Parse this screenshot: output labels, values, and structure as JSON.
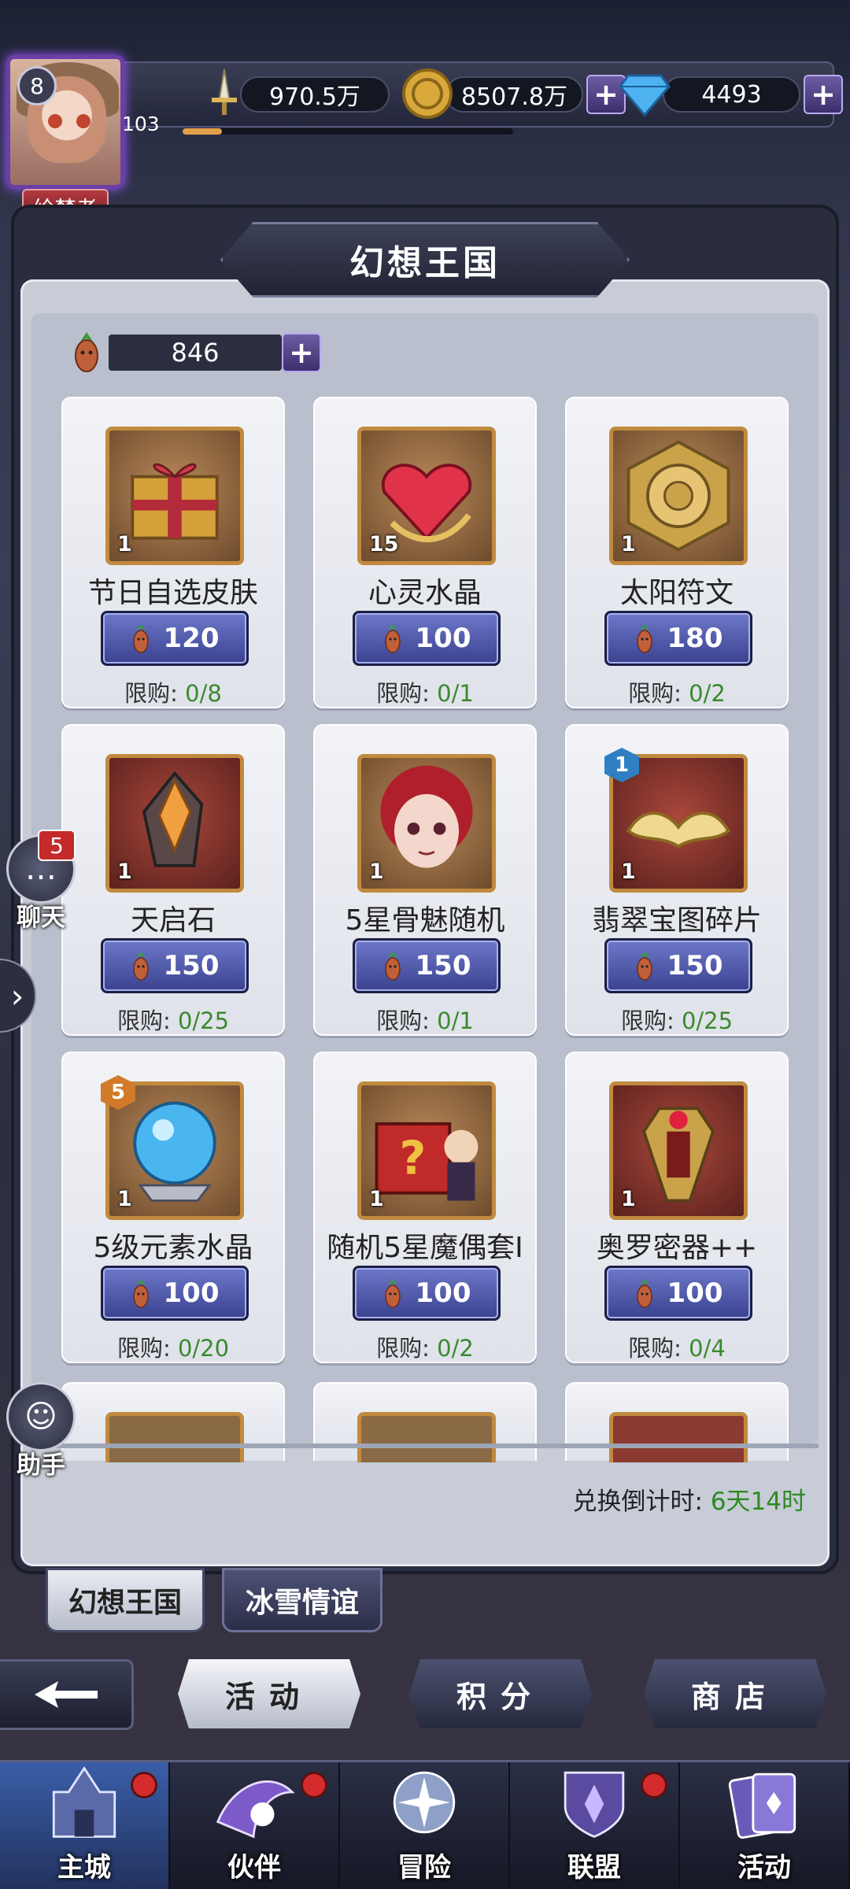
{
  "header": {
    "level": "8",
    "player_title": "绘梦者",
    "exp_value": "103",
    "exp_fraction": 0.12,
    "power": "970.5万",
    "gold": "8507.8万",
    "diamonds": "4493"
  },
  "panel": {
    "title": "幻想王国",
    "currency_count": "846",
    "countdown_label": "兑换倒计时: ",
    "countdown_value": "6天14时"
  },
  "items": [
    {
      "name": "节日自选皮肤",
      "count": "1",
      "price": "120",
      "limit_label": "限购: ",
      "limit": "0/8",
      "icon": "gift-box-icon",
      "bg": "brown"
    },
    {
      "name": "心灵水晶",
      "count": "15",
      "price": "100",
      "limit_label": "限购: ",
      "limit": "0/1",
      "icon": "heart-crystal-icon",
      "bg": "brown"
    },
    {
      "name": "太阳符文",
      "count": "1",
      "price": "180",
      "limit_label": "限购: ",
      "limit": "0/2",
      "icon": "sun-rune-icon",
      "bg": "brown"
    },
    {
      "name": "天启石",
      "count": "1",
      "price": "150",
      "limit_label": "限购: ",
      "limit": "0/25",
      "icon": "apocalypse-stone-icon",
      "bg": "red"
    },
    {
      "name": "5星骨魅随机",
      "count": "1",
      "price": "150",
      "limit_label": "限购: ",
      "limit": "0/1",
      "icon": "character-portrait-icon",
      "bg": "brown"
    },
    {
      "name": "翡翠宝图碎片",
      "count": "1",
      "price": "150",
      "limit_label": "限购: ",
      "limit": "0/25",
      "icon": "map-fragment-icon",
      "bg": "red",
      "rank": "1",
      "rank_color": "#2f7fc2"
    },
    {
      "name": "5级元素水晶",
      "count": "1",
      "price": "100",
      "limit_label": "限购: ",
      "limit": "0/20",
      "icon": "element-crystal-ball-icon",
      "bg": "brown",
      "rank": "5",
      "rank_color": "#d07a2a"
    },
    {
      "name": "随机5星魔偶套I",
      "count": "1",
      "price": "100",
      "limit_label": "限购: ",
      "limit": "0/2",
      "icon": "mystery-chest-icon",
      "bg": "brown"
    },
    {
      "name": "奥罗密器++",
      "count": "1",
      "price": "100",
      "limit_label": "限购: ",
      "limit": "0/4",
      "icon": "relic-artifact-icon",
      "bg": "red"
    }
  ],
  "sub_tabs": [
    "幻想王国",
    "冰雪情谊"
  ],
  "actions": {
    "activity": "活动",
    "points": "积分",
    "shop": "商店"
  },
  "side": {
    "chat_label": "聊天",
    "chat_badge": "5",
    "assistant_label": "助手"
  },
  "nav": [
    {
      "label": "主城",
      "dot": true
    },
    {
      "label": "伙伴",
      "dot": true
    },
    {
      "label": "冒险",
      "dot": false
    },
    {
      "label": "联盟",
      "dot": true
    },
    {
      "label": "活动",
      "dot": false
    }
  ],
  "colors": {
    "accent_blue": "#3a428f",
    "limit_green": "#3a8a2d",
    "frame_gold": "#c18a3f"
  }
}
